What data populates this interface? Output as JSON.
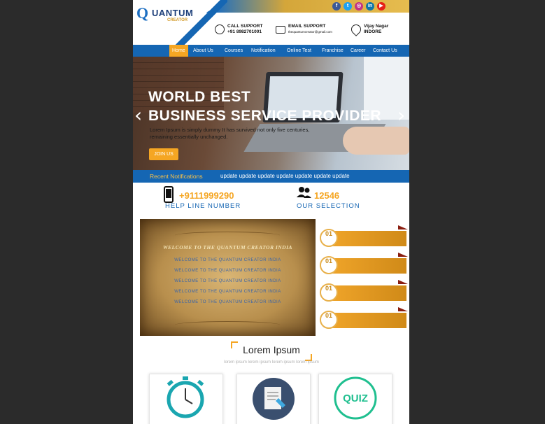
{
  "brand": {
    "logo_letter": "Q",
    "logo_word": "UANTUM",
    "logo_sub": "CREATOR"
  },
  "social": [
    {
      "icon": "facebook-icon",
      "glyph": "f",
      "color": "#3b5998"
    },
    {
      "icon": "twitter-icon",
      "glyph": "t",
      "color": "#1da1f2"
    },
    {
      "icon": "instagram-icon",
      "glyph": "◎",
      "color": "#c13584"
    },
    {
      "icon": "linkedin-icon",
      "glyph": "in",
      "color": "#0e76a8"
    },
    {
      "icon": "youtube-icon",
      "glyph": "▶",
      "color": "#e62117"
    }
  ],
  "contact": {
    "call_title": "CALL SUPPORT",
    "call_value": "+91 8982701001",
    "email_title": "EMAIL SUPPORT",
    "email_value": "thequantumcreator@gmail.com",
    "loc_title": "Vijay Nagar",
    "loc_value": "INDORE"
  },
  "nav": [
    "Home",
    "About Us",
    "Courses",
    "Notification",
    "Online Test",
    "Franchise",
    "Career",
    "Contact Us"
  ],
  "hero": {
    "title_line1": "WORLD BEST",
    "title_line2": "BUSINESS SERVICE PROVIDER",
    "desc": "Lorem Ipsum is simply dummy It has survived not only five centuries, remaining essentially unchanged.",
    "button": "JOIN US",
    "prev": "‹",
    "next": "›"
  },
  "ticker": {
    "label": "Recent Notifications",
    "text": "update update update update update update update"
  },
  "stats": {
    "phone": "+9111999290",
    "phone_caption": "HELP LINE NUMBER",
    "selection": "12546",
    "selection_caption": "OUR SELECTION"
  },
  "welcome": {
    "title": "WELCOME TO THE QUANTUM CREATOR INDIA",
    "lines": [
      "WELCOME TO THE QUANTUM CREATOR INDIA",
      "WELCOME TO THE QUANTUM CREATOR INDIA",
      "WELCOME TO THE QUANTUM CREATOR INDIA",
      "WELCOME TO THE QUANTUM CREATOR INDIA",
      "WELCOME TO THE QUANTUM CREATOR INDIA"
    ]
  },
  "ribbons": [
    "01",
    "01",
    "01",
    "01"
  ],
  "section": {
    "title": "Lorem Ipsum",
    "subtitle": "lorem ipsum lorem ipsum lorem ipsum lorem ipsum"
  },
  "quiz_label": "QUIZ"
}
